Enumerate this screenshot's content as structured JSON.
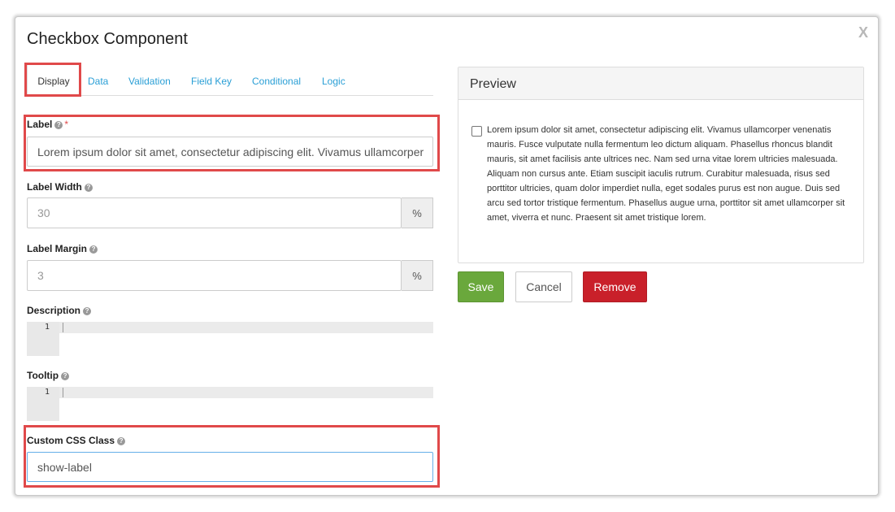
{
  "modal": {
    "title": "Checkbox Component",
    "close_label": "X"
  },
  "tabs": [
    "Display",
    "Data",
    "Validation",
    "Field Key",
    "Conditional",
    "Logic"
  ],
  "form": {
    "label": {
      "label": "Label",
      "required_mark": "*",
      "value": "Lorem ipsum dolor sit amet, consectetur adipiscing elit. Vivamus ullamcorper"
    },
    "label_width": {
      "label": "Label Width",
      "placeholder": "30",
      "addon": "%"
    },
    "label_margin": {
      "label": "Label Margin",
      "placeholder": "3",
      "addon": "%"
    },
    "description": {
      "label": "Description",
      "line_number": "1"
    },
    "tooltip": {
      "label": "Tooltip",
      "line_number": "1"
    },
    "custom_css": {
      "label": "Custom CSS Class",
      "value": "show-label"
    }
  },
  "help_icon": "?",
  "preview": {
    "title": "Preview",
    "checkbox_text": "Lorem ipsum dolor sit amet, consectetur adipiscing elit. Vivamus ullamcorper venenatis mauris. Fusce vulputate nulla fermentum leo dictum aliquam. Phasellus rhoncus blandit mauris, sit amet facilisis ante ultrices nec. Nam sed urna vitae lorem ultricies malesuada. Aliquam non cursus ante. Etiam suscipit iaculis rutrum. Curabitur malesuada, risus sed porttitor ultricies, quam dolor imperdiet nulla, eget sodales purus est non augue. Duis sed arcu sed tortor tristique fermentum. Phasellus augue urna, porttitor sit amet ullamcorper sit amet, viverra et nunc. Praesent sit amet tristique lorem."
  },
  "buttons": {
    "save": "Save",
    "cancel": "Cancel",
    "remove": "Remove"
  },
  "colors": {
    "highlight": "#e0494a",
    "tab_link": "#2a9fd6",
    "save": "#6aa83c",
    "remove": "#c9202a"
  }
}
